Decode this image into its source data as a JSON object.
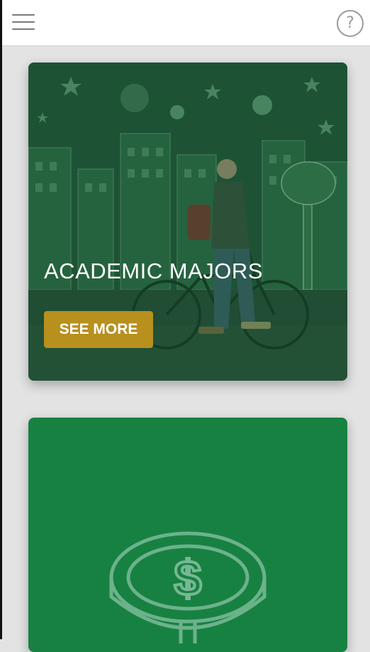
{
  "header": {
    "menu_icon": "hamburger-menu-icon",
    "help_icon": "question-circle-icon",
    "help_glyph": "?"
  },
  "cards": [
    {
      "title": "ACADEMIC MAJORS",
      "button_label": "SEE MORE",
      "background": "illustrated street mural with cyclist",
      "overlay_color": "#1b5a34"
    },
    {
      "icon": "dollar-coin-icon",
      "background_color": "#178142"
    }
  ],
  "colors": {
    "button": "#b8901d",
    "topbar": "#ffffff",
    "page_bg": "#e3e3e3"
  }
}
